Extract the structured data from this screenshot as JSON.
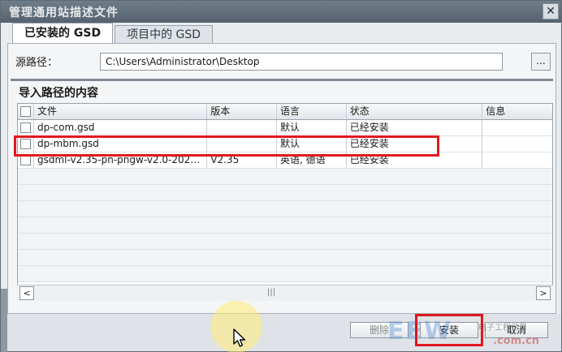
{
  "window": {
    "title": "管理通用站描述文件",
    "close_glyph": "✕"
  },
  "tabs": [
    {
      "label": "已安装的 GSD",
      "active": true
    },
    {
      "label": "项目中的 GSD",
      "active": false
    }
  ],
  "source": {
    "label": "源路径：",
    "path": "C:\\Users\\Administrator\\Desktop",
    "browse_label": "..."
  },
  "section": {
    "title": "导入路径的内容"
  },
  "table": {
    "headers": {
      "file": "文件",
      "version": "版本",
      "language": "语言",
      "status": "状态",
      "info": "信息"
    },
    "rows": [
      {
        "file": "dp-com.gsd",
        "version": "",
        "language": "默认",
        "status": "已经安装",
        "info": ""
      },
      {
        "file": "dp-mbm.gsd",
        "version": "",
        "language": "默认",
        "status": "已经安装",
        "info": ""
      },
      {
        "file": "gsdml-v2.35-pn-pngw-v2.0-2024...",
        "version": "V2.35",
        "language": "英语, 德语",
        "status": "已经安装",
        "info": ""
      }
    ]
  },
  "scrollbar": {
    "left_glyph": "<",
    "right_glyph": ">",
    "grip_glyph": "|||"
  },
  "buttons": {
    "delete": "删除",
    "install": "安装",
    "cancel": "取消"
  },
  "watermark": {
    "logo": "EEW",
    "subtitle": "电子工程世界",
    "site": ".com.cn"
  },
  "colors": {
    "highlight": "#e0181f",
    "titlebar": "#5e6b77"
  }
}
